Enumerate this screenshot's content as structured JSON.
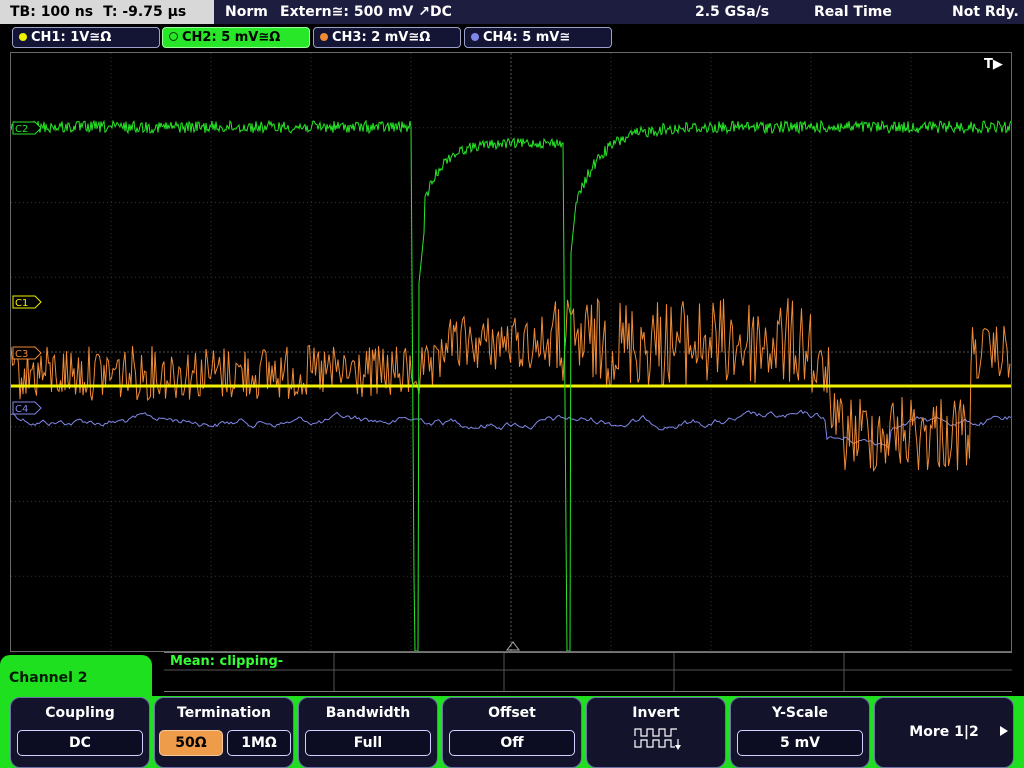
{
  "status_bar": {
    "timebase": "TB: 100 ns",
    "trigger_time": "T: -9.75 µs",
    "trigger_mode": "Norm",
    "trigger_source": "Extern≅: 500 mV ↗DC",
    "sample_rate": "2.5 GSa/s",
    "acq_mode": "Real Time",
    "ready_state": "Not Rdy."
  },
  "channels": [
    {
      "label": "CH1: 1V≅Ω",
      "color": "#f0f000",
      "active": false
    },
    {
      "label": "CH2: 5 mV≅Ω",
      "color": "#28e628",
      "active": true
    },
    {
      "label": "CH3: 2 mV≅Ω",
      "color": "#ef8a36",
      "active": false
    },
    {
      "label": "CH4: 5 mV≅",
      "color": "#7f86e8",
      "active": false
    }
  ],
  "grid": {
    "trigger_marker": "T▶",
    "markers": {
      "ch1": "C1",
      "ch2": "C2",
      "ch3": "C3",
      "ch4": "C4"
    }
  },
  "measurement": {
    "text": "Mean: clipping-"
  },
  "menu": {
    "title": "Channel 2",
    "coupling": {
      "label": "Coupling",
      "value": "DC"
    },
    "termination": {
      "label": "Termination",
      "options": [
        "50Ω",
        "1MΩ"
      ],
      "selected": "50Ω"
    },
    "bandwidth": {
      "label": "Bandwidth",
      "value": "Full"
    },
    "offset": {
      "label": "Offset",
      "value": "Off"
    },
    "invert": {
      "label": "Invert",
      "icon": "invert-waveform-icon"
    },
    "yscale": {
      "label": "Y-Scale",
      "value": "5 mV"
    },
    "more": {
      "label": "More 1|2",
      "icon": "play-right-icon"
    }
  },
  "colors": {
    "ch1": "#f0f000",
    "ch2": "#28e628",
    "ch3": "#ef8a36",
    "ch4": "#7f86e8",
    "menu_accent": "#1fe01f"
  }
}
